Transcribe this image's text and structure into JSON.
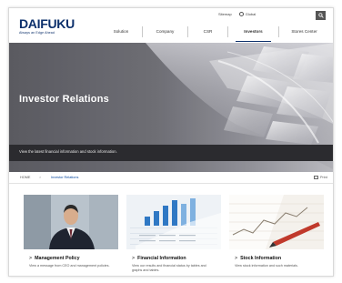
{
  "header": {
    "logo": "DAIFUKU",
    "logo_tagline": "Always an Edge Ahead",
    "utility": {
      "sitemap": "Sitemap",
      "global": "Global"
    },
    "nav": [
      {
        "label": "Solution",
        "active": false
      },
      {
        "label": "Company",
        "active": false
      },
      {
        "label": "CSR",
        "active": false
      },
      {
        "label": "Investors",
        "active": true
      },
      {
        "label": "Stores Center",
        "active": false
      }
    ]
  },
  "hero": {
    "title": "Investor Relations",
    "description": "View the latest financial information and stock information."
  },
  "breadcrumb": {
    "home": "HOME",
    "separator": ">",
    "current": "Investor Relations",
    "print": "Print"
  },
  "cards": [
    {
      "title": "Management Policy",
      "description": "View a message from CEO and management policies."
    },
    {
      "title": "Financial Information",
      "description": "View our results and financial status by tables and graphs and tables."
    },
    {
      "title": "Stock Information",
      "description": "View stock information and such materials."
    }
  ],
  "colors": {
    "brand": "#0b2f6b",
    "hero_bar": "#2b2b2f",
    "link": "#0b4aa0"
  }
}
